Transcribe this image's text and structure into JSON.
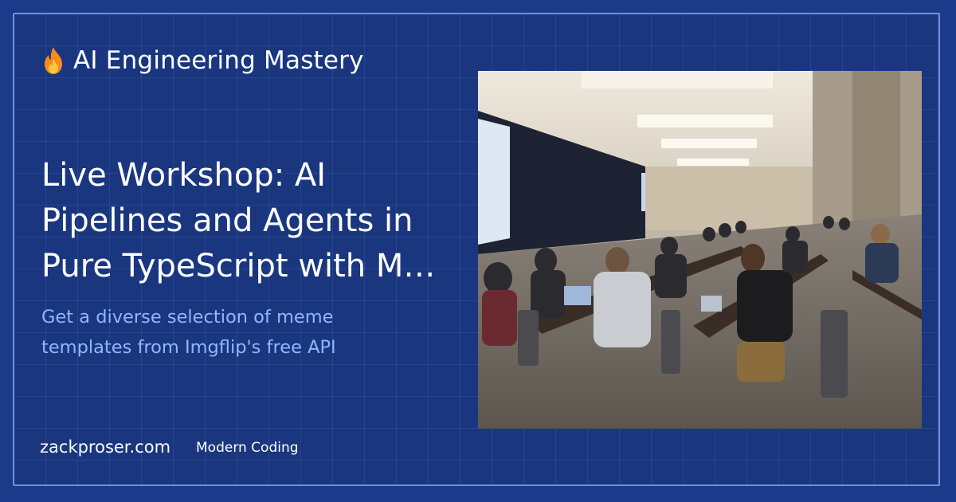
{
  "brand": {
    "icon": "fire-icon",
    "title": "AI Engineering Mastery"
  },
  "main": {
    "title_line1": "Live Workshop: AI",
    "title_line2": "Pipelines and Agents in",
    "title_line3": "Pure TypeScript with M…",
    "subtitle_line1": "Get a diverse selection of meme",
    "subtitle_line2": "templates from Imgflip's free API"
  },
  "footer": {
    "site": "zackproser.com",
    "tag": "Modern Coding"
  },
  "photo": {
    "description_icon": "workshop-photo"
  },
  "colors": {
    "background": "#1a367f",
    "border": "#6f8fdc",
    "subtitle": "#8fb7ff",
    "text": "#ffffff"
  }
}
